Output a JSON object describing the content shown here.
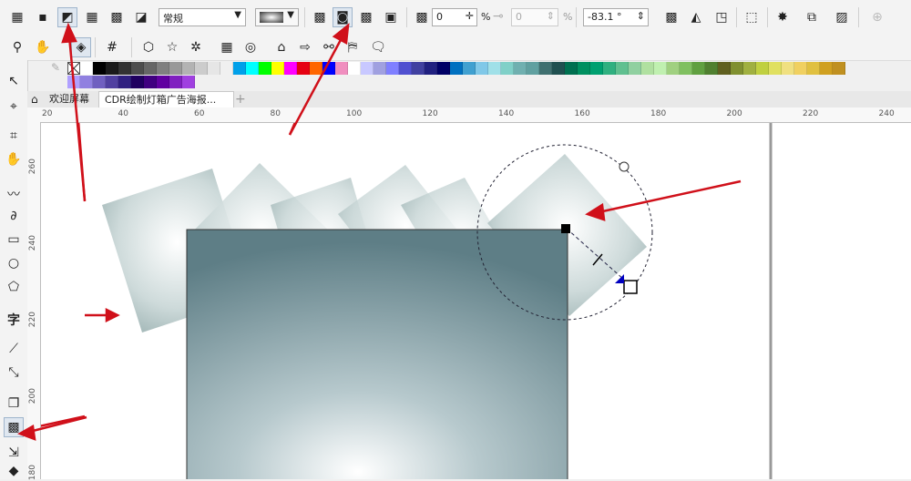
{
  "property_bar": {
    "preset_value": "常规",
    "offset_value": "0",
    "offset_unit": "%",
    "offset2_value": "0",
    "offset2_unit": "%",
    "angle_value": "-83.1 °"
  },
  "palette_colors": [
    "#ffffff",
    "#000000",
    "#1a1a1a",
    "#333333",
    "#4d4d4d",
    "#666666",
    "#808080",
    "#999999",
    "#b3b3b3",
    "#cccccc",
    "#e6e6e6",
    "#f0f0f0",
    "#00a0e9",
    "#00ffff",
    "#00ff00",
    "#ffff00",
    "#ff00ff",
    "#e60012",
    "#ff6600",
    "#0000ff",
    "#f08ebf",
    "#ffffff",
    "#c8c8ff",
    "#a0a0e0",
    "#7f7fff",
    "#5050d0",
    "#4040a0",
    "#202080",
    "#000066",
    "#0070c0",
    "#40a0d0",
    "#80c8e8",
    "#a0e0e8",
    "#80d0c8",
    "#70b0b0",
    "#60a0a0",
    "#407070",
    "#205050",
    "#007050",
    "#009060",
    "#00a070",
    "#30b080",
    "#60c090",
    "#90d0a0",
    "#b0e0a0",
    "#c0f0b0",
    "#a0d080",
    "#80c060",
    "#60a040",
    "#508030",
    "#606020",
    "#809030",
    "#a0b040",
    "#c0d040",
    "#e0e060",
    "#f0e080",
    "#f0d060",
    "#e0c040",
    "#d0a020",
    "#c09020"
  ],
  "palette_colors2": [
    "#b0a0ff",
    "#9080e0",
    "#7060c0",
    "#5040a0",
    "#302080",
    "#200060",
    "#400080",
    "#6000a0",
    "#8020c0",
    "#a040e0"
  ],
  "tabs": [
    "欢迎屏幕",
    "CDR绘制灯箱广告海报..."
  ],
  "hruler_labels": [
    "20",
    "40",
    "60",
    "80",
    "100",
    "120",
    "140",
    "160",
    "180",
    "200",
    "220",
    "240"
  ],
  "vruler_labels": [
    "260",
    "240",
    "220",
    "200",
    "180"
  ],
  "icons": {
    "home": "home-icon",
    "add_tab": "plus-icon"
  }
}
